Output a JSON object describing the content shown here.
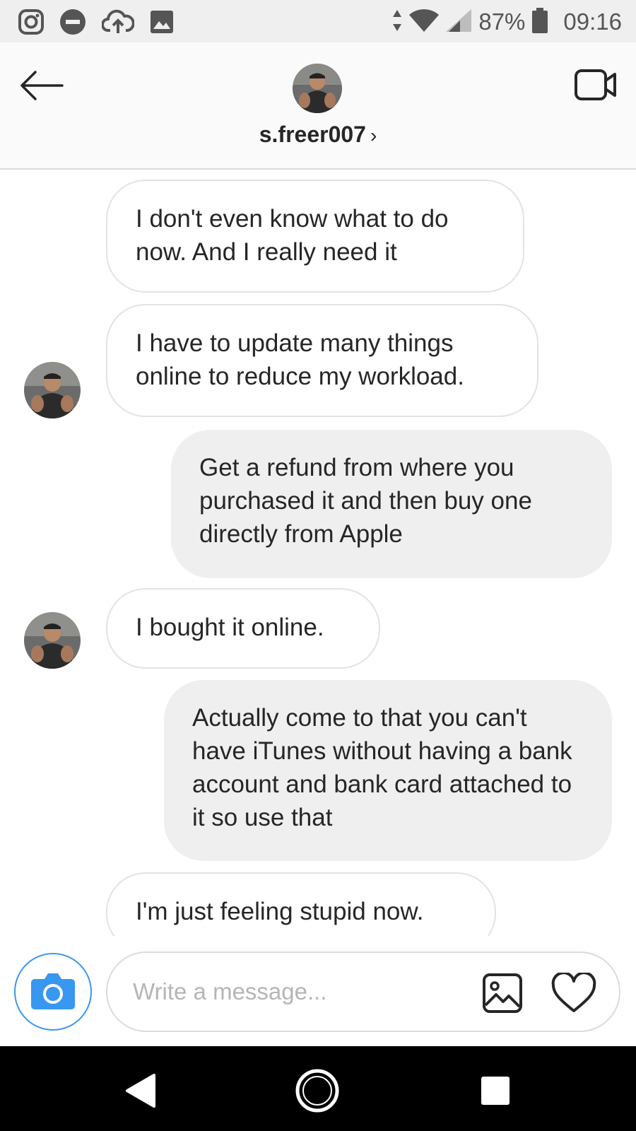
{
  "status_bar": {
    "battery_percent": "87%",
    "time": "09:16",
    "left_icons": [
      "instagram-icon",
      "do-not-disturb-icon",
      "cloud-upload-icon",
      "image-icon"
    ],
    "right_icons": [
      "data-arrows-icon",
      "wifi-icon",
      "cellular-signal-icon",
      "battery-icon"
    ]
  },
  "header": {
    "username": "s.freer007",
    "chevron": "›",
    "icons": [
      "back-arrow-icon",
      "video-call-icon"
    ]
  },
  "messages": [
    {
      "id": 1,
      "direction": "incoming",
      "text": "I don't even know what to do now. And I really need it",
      "show_avatar": false
    },
    {
      "id": 2,
      "direction": "incoming",
      "text": "I have to update many things online to reduce my workload.",
      "show_avatar": true
    },
    {
      "id": 3,
      "direction": "outgoing",
      "text": "Get a refund from where you purchased it and then buy one directly from Apple"
    },
    {
      "id": 4,
      "direction": "incoming",
      "text": "I bought it online.",
      "show_avatar": true
    },
    {
      "id": 5,
      "direction": "outgoing",
      "text": "Actually come to that you can't have iTunes without having a bank account and bank card attached to it so use that"
    },
    {
      "id": 6,
      "direction": "incoming",
      "text": "I'm just feeling stupid now.",
      "show_avatar": false
    }
  ],
  "composer": {
    "placeholder": "Write a message...",
    "value": "",
    "icons": [
      "camera-icon",
      "gallery-icon",
      "heart-icon"
    ],
    "accent_color": "#3897f0"
  },
  "nav_bar": {
    "icons": [
      "nav-back-icon",
      "nav-home-icon",
      "nav-recents-icon"
    ]
  },
  "colors": {
    "outgoing_bubble": "#efefef",
    "incoming_border": "#e3e3e3",
    "text": "#262626",
    "status_bar_bg": "#efefef"
  }
}
